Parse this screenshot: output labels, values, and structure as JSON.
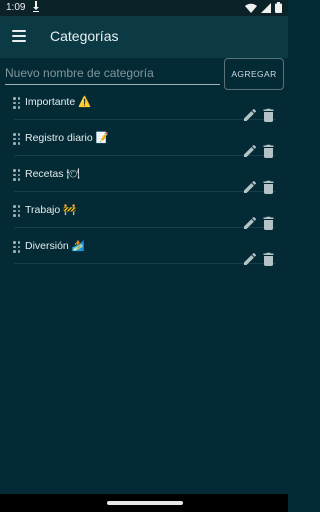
{
  "status_bar": {
    "time": "1:09"
  },
  "app_bar": {
    "title": "Categorías"
  },
  "new_category": {
    "placeholder": "Nuevo nombre de categoría",
    "value": "",
    "add_label": "AGREGAR"
  },
  "categories": [
    {
      "label": "Importante ⚠️"
    },
    {
      "label": "Registro diario 📝"
    },
    {
      "label": "Recetas 🍽"
    },
    {
      "label": "Trabajo 🚧"
    },
    {
      "label": "Diversión 🏄"
    }
  ],
  "colors": {
    "background": "#042b35",
    "app_bar": "#0b3944",
    "icon": "#b4c3c6"
  }
}
